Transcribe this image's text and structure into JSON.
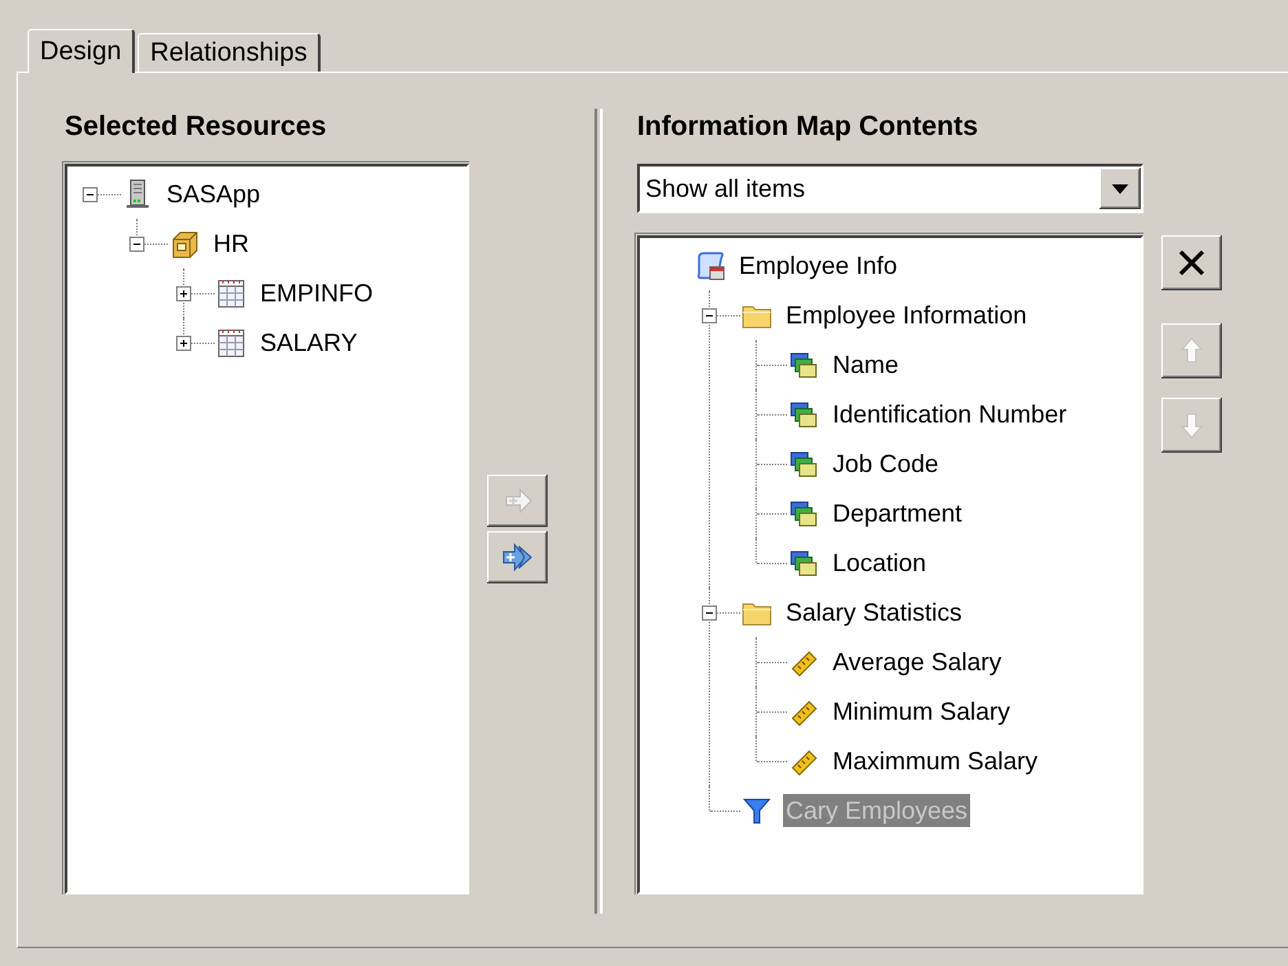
{
  "tabs": [
    {
      "label": "Design",
      "selected": true
    },
    {
      "label": "Relationships",
      "selected": false
    }
  ],
  "resources": {
    "title": "Selected Resources",
    "tree": [
      {
        "label": "SASApp",
        "kind": "server",
        "expanded": true,
        "selected": false,
        "children": [
          {
            "label": "HR",
            "kind": "library",
            "expanded": true,
            "selected": false,
            "children": [
              {
                "label": "EMPINFO",
                "kind": "table",
                "expanded": false,
                "selected": false
              },
              {
                "label": "SALARY",
                "kind": "table",
                "expanded": false,
                "selected": false
              }
            ]
          }
        ]
      }
    ]
  },
  "transfer_buttons": [
    {
      "kind": "add",
      "disabled": true
    },
    {
      "kind": "add_all",
      "disabled": false
    }
  ],
  "contents": {
    "title": "Information Map Contents",
    "filter": {
      "value": "Show all items"
    },
    "tree": [
      {
        "label": "Employee Info",
        "kind": "map",
        "selected": false,
        "children": [
          {
            "label": "Employee Information",
            "kind": "folder",
            "expanded": true,
            "selected": false,
            "children": [
              {
                "label": "Name",
                "kind": "data_item",
                "selected": false
              },
              {
                "label": "Identification Number",
                "kind": "data_item",
                "selected": false
              },
              {
                "label": "Job Code",
                "kind": "data_item",
                "selected": false
              },
              {
                "label": "Department",
                "kind": "data_item",
                "selected": false
              },
              {
                "label": "Location",
                "kind": "data_item",
                "selected": false
              }
            ]
          },
          {
            "label": "Salary Statistics",
            "kind": "folder",
            "expanded": true,
            "selected": false,
            "children": [
              {
                "label": "Average Salary",
                "kind": "measure",
                "selected": false
              },
              {
                "label": "Minimum Salary",
                "kind": "measure",
                "selected": false
              },
              {
                "label": "Maximmum Salary",
                "kind": "measure",
                "selected": false
              }
            ]
          },
          {
            "label": "Cary Employees",
            "kind": "filter",
            "selected": true
          }
        ]
      }
    ]
  },
  "tool_buttons": [
    {
      "kind": "delete",
      "disabled": false
    },
    {
      "kind": "move_up",
      "disabled": true
    },
    {
      "kind": "move_down",
      "disabled": true
    }
  ]
}
